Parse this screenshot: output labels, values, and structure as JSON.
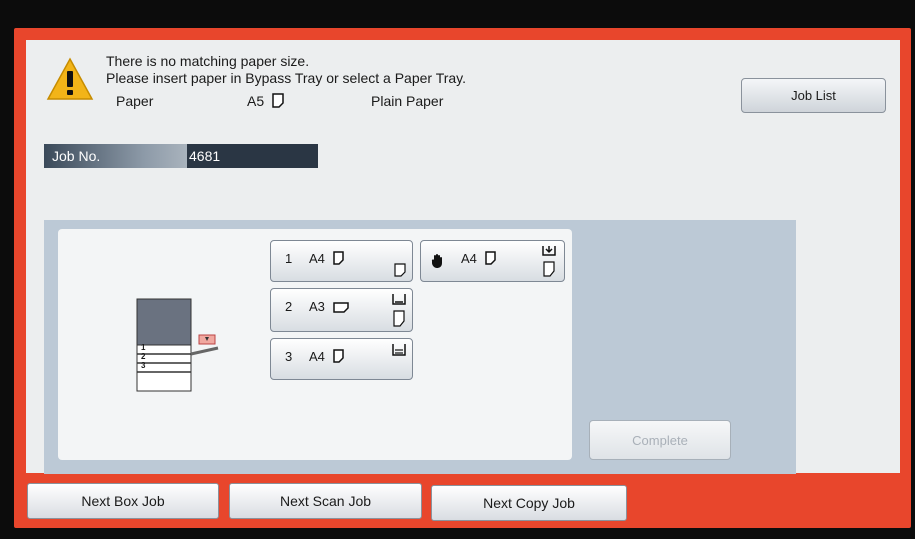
{
  "message": {
    "line1": "There is no matching paper size.",
    "line2": "Please insert paper in Bypass Tray or select a Paper Tray.",
    "paper_label": "Paper",
    "paper_size": "A5",
    "paper_type": "Plain Paper"
  },
  "job_list_button": "Job List",
  "job": {
    "label": "Job No.",
    "number": "4681"
  },
  "trays": [
    {
      "num": "1",
      "size": "A4"
    },
    {
      "num": "2",
      "size": "A3"
    },
    {
      "num": "3",
      "size": "A4"
    }
  ],
  "bypass_tray": {
    "size": "A4"
  },
  "machine_labels": [
    "1",
    "2",
    "3"
  ],
  "complete_button": "Complete",
  "bottom_buttons": [
    "Next Box Job",
    "Next Scan Job",
    "Next Copy Job"
  ],
  "colors": {
    "frame": "#e8462c",
    "warning": "#f2b418",
    "job_bar": "#2a3644"
  }
}
